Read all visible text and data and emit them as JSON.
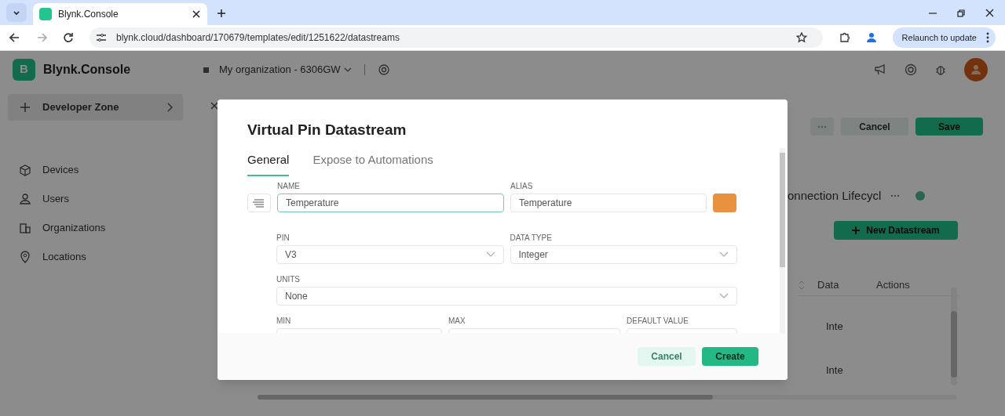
{
  "browser": {
    "tabs": [
      {
        "title": "Blynk.Console",
        "selected": true
      }
    ],
    "url": "blynk.cloud/dashboard/170679/templates/edit/1251622/datastreams",
    "relaunch_button": "Relaunch to update"
  },
  "header": {
    "logo_letter": "B",
    "brand": "Blynk.Console",
    "organization": "My organization - 6306GW"
  },
  "sidebar": {
    "items": [
      {
        "label": "Developer Zone",
        "selected": true
      },
      {
        "label": "Devices",
        "selected": false
      },
      {
        "label": "Users",
        "selected": false
      },
      {
        "label": "Organizations",
        "selected": false
      },
      {
        "label": "Locations",
        "selected": false
      }
    ]
  },
  "background": {
    "cancel_button": "Cancel",
    "save_button": "Save",
    "section_title": "onnection Lifecycl",
    "new_datastream_button": "New Datastream",
    "table": {
      "columns": [
        "Data",
        "Actions"
      ],
      "rows": [
        [
          "Inte"
        ],
        [
          "Inte"
        ]
      ]
    }
  },
  "modal": {
    "title": "Virtual Pin Datastream",
    "tabs": [
      {
        "label": "General",
        "selected": true
      },
      {
        "label": "Expose to Automations",
        "selected": false
      }
    ],
    "name": {
      "label": "NAME",
      "value": "Temperature",
      "focused": true
    },
    "alias": {
      "label": "ALIAS",
      "value": "Temperature",
      "focused": false
    },
    "color": "#e8913f",
    "pin": {
      "label": "PIN",
      "value": "V3"
    },
    "data_type": {
      "label": "DATA TYPE",
      "value": "Integer"
    },
    "units": {
      "label": "UNITS",
      "value": "None"
    },
    "min": {
      "label": "MIN"
    },
    "max": {
      "label": "MAX"
    },
    "default_value": {
      "label": "DEFAULT VALUE"
    },
    "buttons": {
      "cancel": "Cancel",
      "create": "Create"
    }
  }
}
